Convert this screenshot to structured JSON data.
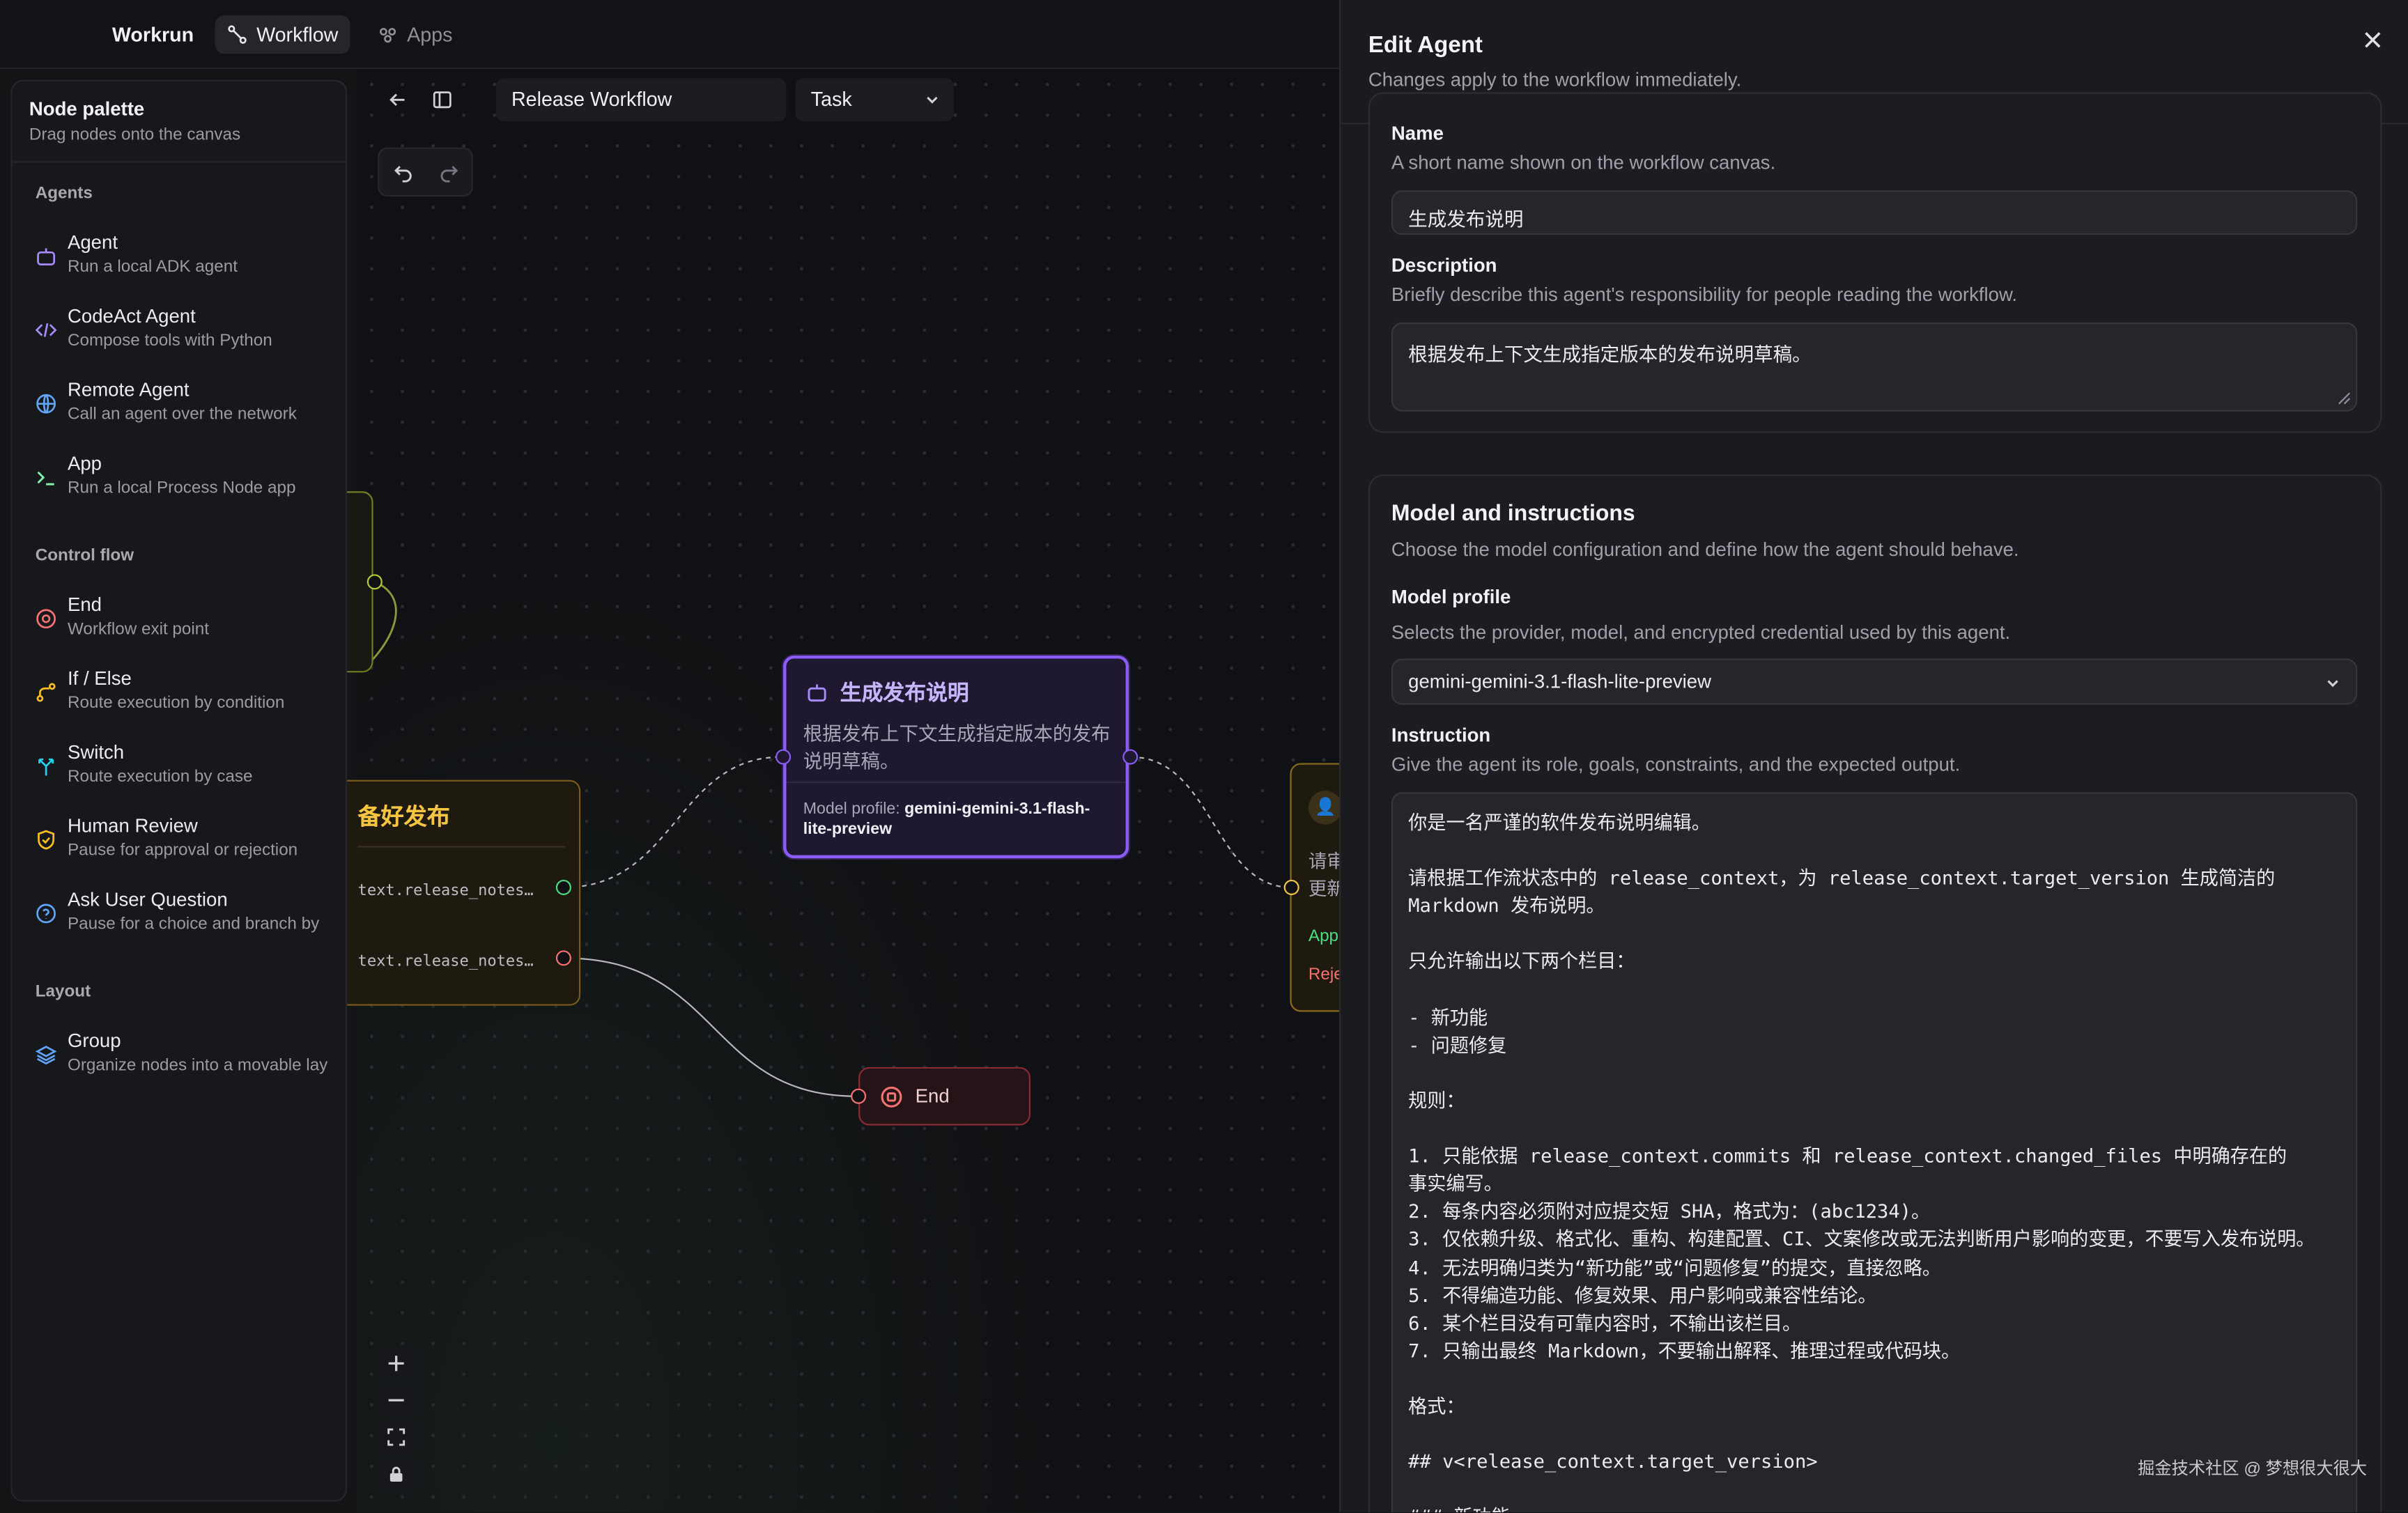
{
  "topbar": {
    "brand": "Workrun",
    "nav": [
      {
        "label": "Workflow",
        "icon": "workflow-icon",
        "active": true
      },
      {
        "label": "Apps",
        "icon": "apps-icon",
        "active": false
      }
    ]
  },
  "palette": {
    "title": "Node palette",
    "subtitle": "Drag nodes onto the canvas",
    "sections": {
      "agents": "Agents",
      "control_flow": "Control flow",
      "layout": "Layout"
    },
    "items": [
      {
        "name": "Agent",
        "desc": "Run a local ADK agent",
        "icon": "robot-icon",
        "color": "#a78bfa"
      },
      {
        "name": "CodeAct Agent",
        "desc": "Compose tools with Python",
        "icon": "code-icon",
        "color": "#a78bfa"
      },
      {
        "name": "Remote Agent",
        "desc": "Call an agent over the network",
        "icon": "globe-icon",
        "color": "#60a5fa"
      },
      {
        "name": "App",
        "desc": "Run a local Process Node app",
        "icon": "terminal-icon",
        "color": "#86efac"
      },
      {
        "name": "End",
        "desc": "Workflow exit point",
        "icon": "stop-circle-icon",
        "color": "#f87171"
      },
      {
        "name": "If / Else",
        "desc": "Route execution by condition",
        "icon": "branch-icon",
        "color": "#fbbf24"
      },
      {
        "name": "Switch",
        "desc": "Route execution by case",
        "icon": "switch-icon",
        "color": "#22d3ee"
      },
      {
        "name": "Human Review",
        "desc": "Pause for approval or rejection",
        "icon": "shield-icon",
        "color": "#fbbf24"
      },
      {
        "name": "Ask User Question",
        "desc": "Pause for a choice and branch by",
        "icon": "question-icon",
        "color": "#60a5fa"
      },
      {
        "name": "Group",
        "desc": "Organize nodes into a movable lay",
        "icon": "layers-icon",
        "color": "#60a5fa"
      }
    ]
  },
  "toolbar": {
    "workflow_name": "Release Workflow",
    "mode": "Task"
  },
  "canvas": {
    "prepare_node": {
      "title": "备好发布",
      "out1": "text.release_notes…",
      "out2": "text.release_notes…"
    },
    "agent_node": {
      "title": "生成发布说明",
      "desc": "根据发布上下文生成指定版本的发布说明草稿。",
      "profile_label": "Model profile: ",
      "profile_value": "gemini-gemini-3.1-flash-lite-preview"
    },
    "end_node": {
      "label": "End"
    },
    "review_node": {
      "line1": "请审",
      "line2": "更新",
      "approve": "App",
      "reject": "Reje"
    }
  },
  "panel": {
    "title": "Edit Agent",
    "subtitle": "Changes apply to the workflow immediately.",
    "name_label": "Name",
    "name_hint": "A short name shown on the workflow canvas.",
    "name_value": "生成发布说明",
    "desc_label": "Description",
    "desc_hint": "Briefly describe this agent's responsibility for people reading the workflow.",
    "desc_value": "根据发布上下文生成指定版本的发布说明草稿。",
    "model_section_title": "Model and instructions",
    "model_section_sub": "Choose the model configuration and define how the agent should behave.",
    "profile_label": "Model profile",
    "profile_hint": "Selects the provider, model, and encrypted credential used by this agent.",
    "profile_value": "gemini-gemini-3.1-flash-lite-preview",
    "instruction_label": "Instruction",
    "instruction_hint": "Give the agent its role, goals, constraints, and the expected output.",
    "instruction_value": "你是一名严谨的软件发布说明编辑。\n\n请根据工作流状态中的 release_context，为 release_context.target_version 生成简洁的\nMarkdown 发布说明。\n\n只允许输出以下两个栏目：\n\n- 新功能\n- 问题修复\n\n规则：\n\n1. 只能依据 release_context.commits 和 release_context.changed_files 中明确存在的\n事实编写。\n2. 每条内容必须附对应提交短 SHA，格式为：(abc1234)。\n3. 仅依赖升级、格式化、重构、构建配置、CI、文案修改或无法判断用户影响的变更，不要写入发布说明。\n4. 无法明确归类为“新功能”或“问题修复”的提交，直接忽略。\n5. 不得编造功能、修复效果、用户影响或兼容性结论。\n6. 某个栏目没有可靠内容时，不输出该栏目。\n7. 只输出最终 Markdown，不要输出解释、推理过程或代码块。\n\n格式：\n\n## v<release_context.target_version>\n\n### 新功能"
  },
  "watermark": "掘金技术社区 @ 梦想很大很大"
}
